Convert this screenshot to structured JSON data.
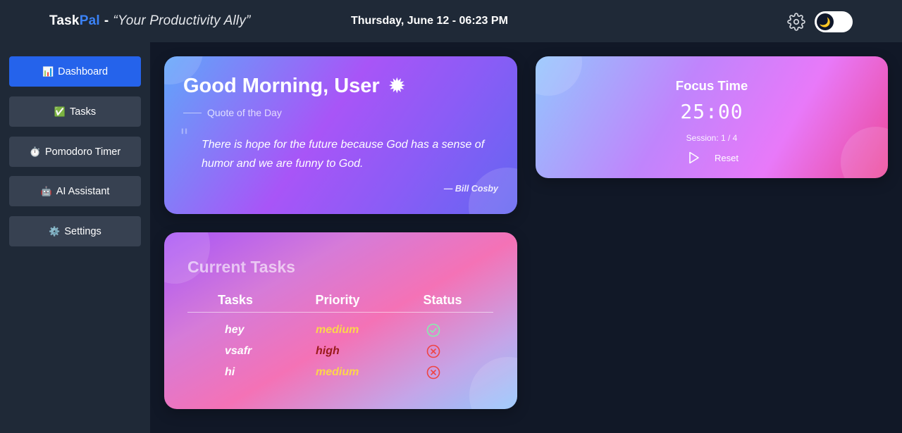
{
  "header": {
    "brand_task": "Task",
    "brand_pal": "Pal",
    "brand_dash": "-",
    "tagline": "“Your Productivity Ally”",
    "datetime": "Thursday, June 12 - 06:23 PM",
    "settings_icon": "gear-icon",
    "theme_toggle_icon": "moon-icon"
  },
  "sidebar": {
    "items": [
      {
        "icon": "📊",
        "label": "Dashboard",
        "active": true
      },
      {
        "icon": "✅",
        "label": "Tasks",
        "active": false
      },
      {
        "icon": "⏱️",
        "label": "Pomodoro Timer",
        "active": false
      },
      {
        "icon": "🤖",
        "label": "AI Assistant",
        "active": false
      },
      {
        "icon": "⚙️",
        "label": "Settings",
        "active": false
      }
    ]
  },
  "greeting": {
    "text": "Good Morning, User",
    "icon": "sun-icon",
    "quote_label": "Quote of the Day",
    "quote_mark": "\"",
    "quote": "There is hope for the future because God has a sense of humor and we are funny to God.",
    "author": "— Bill Cosby"
  },
  "focus": {
    "title": "Focus Time",
    "time": "25:00",
    "session": "Session: 1 / 4",
    "play_icon": "play-icon",
    "reset_label": "Reset"
  },
  "tasks": {
    "title": "Current Tasks",
    "headers": [
      "Tasks",
      "Priority",
      "Status"
    ],
    "rows": [
      {
        "name": "hey",
        "priority": "medium",
        "status": "done"
      },
      {
        "name": "vsafr",
        "priority": "high",
        "status": "pending"
      },
      {
        "name": "hi",
        "priority": "medium",
        "status": "pending"
      }
    ]
  },
  "colors": {
    "accent": "#2563eb",
    "brand_pal": "#3b82f6",
    "priority_medium": "#fcd34d",
    "priority_high": "#991b1b",
    "status_done": "#86efac",
    "status_pending": "#ef4444"
  }
}
